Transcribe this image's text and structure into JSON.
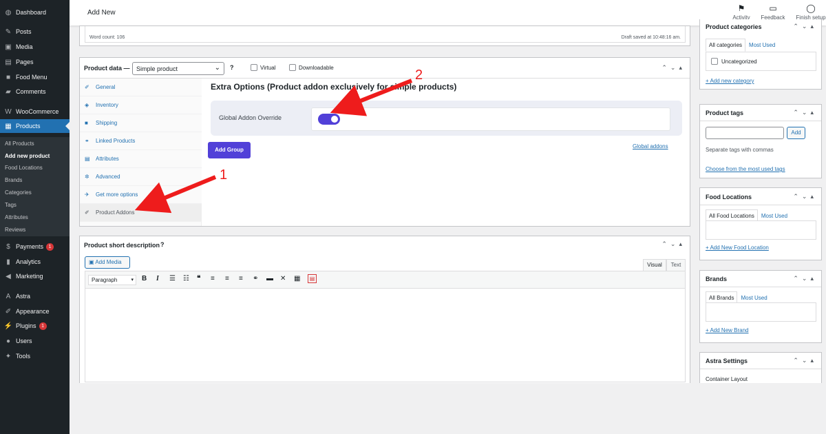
{
  "sidebar": {
    "menu": [
      {
        "label": "Dashboard",
        "icon": "dashboard-icon",
        "glyph": "◍"
      },
      {
        "label": "Posts",
        "icon": "pin-icon",
        "glyph": "✎"
      },
      {
        "label": "Media",
        "icon": "media-icon",
        "glyph": "▣"
      },
      {
        "label": "Pages",
        "icon": "pages-icon",
        "glyph": "▤"
      },
      {
        "label": "Food Menu",
        "icon": "food-menu-icon",
        "glyph": "■"
      },
      {
        "label": "Comments",
        "icon": "comments-icon",
        "glyph": "▰"
      },
      {
        "label": "WooCommerce",
        "icon": "woocommerce-icon",
        "glyph": "W"
      },
      {
        "label": "Products",
        "icon": "products-icon",
        "glyph": "▦"
      },
      {
        "label": "Payments",
        "icon": "payments-icon",
        "glyph": "$",
        "badge": "1"
      },
      {
        "label": "Analytics",
        "icon": "analytics-icon",
        "glyph": "▮"
      },
      {
        "label": "Marketing",
        "icon": "marketing-icon",
        "glyph": "◀"
      },
      {
        "label": "Astra",
        "icon": "astra-icon",
        "glyph": "A"
      },
      {
        "label": "Appearance",
        "icon": "appearance-icon",
        "glyph": "✐"
      },
      {
        "label": "Plugins",
        "icon": "plugins-icon",
        "glyph": "⚡",
        "badge": "1"
      },
      {
        "label": "Users",
        "icon": "users-icon",
        "glyph": "●"
      },
      {
        "label": "Tools",
        "icon": "tools-icon",
        "glyph": "✦"
      }
    ],
    "submenu": [
      "All Products",
      "Add new product",
      "Food Locations",
      "Brands",
      "Categories",
      "Tags",
      "Attributes",
      "Reviews"
    ]
  },
  "topbar": {
    "title": "Add New",
    "activity": "Activity",
    "feedback": "Feedback",
    "finish_setup": "Finish setup"
  },
  "editor_footer": {
    "word_count": "Word count: 106",
    "draft_saved": "Draft saved at 10:48:16 am."
  },
  "product_data": {
    "label": "Product data —",
    "type_value": "Simple product",
    "virtual": "Virtual",
    "downloadable": "Downloadable",
    "tabs": [
      {
        "label": "General",
        "glyph": "✐",
        "icon": "wrench-icon"
      },
      {
        "label": "Inventory",
        "glyph": "◈",
        "icon": "inventory-icon"
      },
      {
        "label": "Shipping",
        "glyph": "■",
        "icon": "truck-icon"
      },
      {
        "label": "Linked Products",
        "glyph": "⚭",
        "icon": "link-icon"
      },
      {
        "label": "Attributes",
        "glyph": "▤",
        "icon": "attributes-icon"
      },
      {
        "label": "Advanced",
        "glyph": "✲",
        "icon": "gear-icon"
      },
      {
        "label": "Get more options",
        "glyph": "✈",
        "icon": "plugin-icon"
      },
      {
        "label": "Product Addons",
        "glyph": "✐",
        "icon": "wrench-icon"
      }
    ],
    "heading": "Extra Options (Product addon exclusively for simple products)",
    "override_label": "Global Addon Override",
    "override_on": true,
    "add_group": "Add Group",
    "global_addons": "Global addons"
  },
  "short_desc": {
    "title": "Product short description",
    "add_media": "Add Media",
    "tab_visual": "Visual",
    "tab_text": "Text",
    "format": "Paragraph"
  },
  "categories": {
    "title": "Product categories",
    "tab_all": "All categories",
    "tab_most": "Most Used",
    "item": "Uncategorized",
    "add_link": "+ Add new category"
  },
  "tags": {
    "title": "Product tags",
    "add_btn": "Add",
    "hint": "Separate tags with commas",
    "choose": "Choose from the most used tags"
  },
  "food_locations": {
    "title": "Food Locations",
    "tab_all": "All Food Locations",
    "tab_most": "Most Used",
    "add_link": "+ Add New Food Location"
  },
  "brands": {
    "title": "Brands",
    "tab_all": "All Brands",
    "tab_most": "Most Used",
    "add_link": "+ Add New Brand"
  },
  "astra": {
    "title": "Astra Settings",
    "container": "Container Layout"
  },
  "annotations": {
    "arrow1": "1",
    "arrow2": "2",
    "color": "#ee1c1c"
  },
  "colors": {
    "sidebar": "#1d2327",
    "active": "#2271b1",
    "accent_purple": "#5140d8"
  }
}
